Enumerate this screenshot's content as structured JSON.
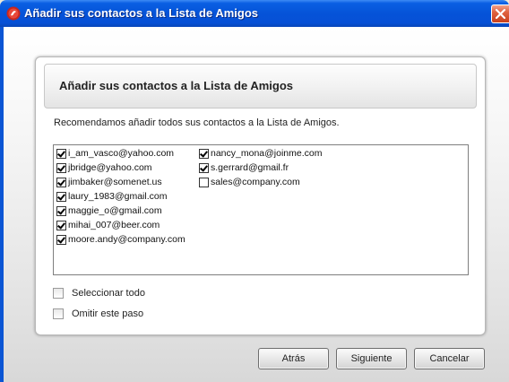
{
  "window": {
    "title": "Añadir sus contactos a la Lista de Amigos"
  },
  "panel": {
    "heading": "Añadir sus contactos a la Lista de Amigos",
    "recommendation": "Recomendamos añadir todos sus contactos a la Lista de Amigos."
  },
  "contacts": [
    {
      "email": "i_am_vasco@yahoo.com",
      "checked": true
    },
    {
      "email": "jbridge@yahoo.com",
      "checked": true
    },
    {
      "email": "jimbaker@somenet.us",
      "checked": true
    },
    {
      "email": "laury_1983@gmail.com",
      "checked": true
    },
    {
      "email": "maggie_o@gmail.com",
      "checked": true
    },
    {
      "email": "mihai_007@beer.com",
      "checked": true
    },
    {
      "email": "moore.andy@company.com",
      "checked": true
    },
    {
      "email": "nancy_mona@joinme.com",
      "checked": true
    },
    {
      "email": "s.gerrard@gmail.fr",
      "checked": true
    },
    {
      "email": "sales@company.com",
      "checked": false
    }
  ],
  "options": {
    "select_all": {
      "label": "Seleccionar todo",
      "checked": false
    },
    "skip_step": {
      "label": "Omitir este paso",
      "checked": false
    }
  },
  "buttons": {
    "back": "Atrás",
    "next": "Siguiente",
    "cancel": "Cancelar"
  },
  "colors": {
    "titlebar": "#0553d8",
    "close_button": "#e0623f"
  }
}
